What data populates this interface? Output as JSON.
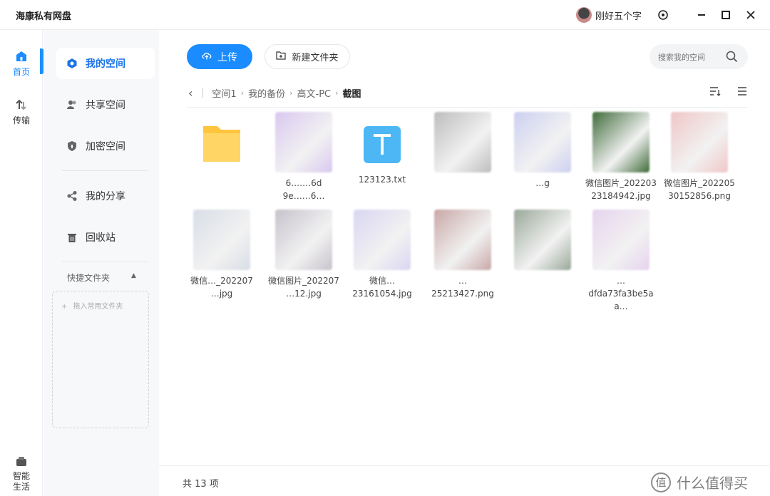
{
  "app": {
    "title": "海康私有网盘"
  },
  "user": {
    "name": "刚好五个字"
  },
  "rail": [
    {
      "label": "首页",
      "icon": "home-icon"
    },
    {
      "label": "传输",
      "icon": "transfer-icon"
    },
    {
      "label": "智能\n生活",
      "icon": "smart-life-icon"
    }
  ],
  "sidebar": {
    "items": [
      {
        "label": "我的空间",
        "icon": "my-space-icon",
        "active": true
      },
      {
        "label": "共享空间",
        "icon": "shared-space-icon"
      },
      {
        "label": "加密空间",
        "icon": "encrypted-space-icon"
      },
      {
        "label": "我的分享",
        "icon": "share-icon"
      },
      {
        "label": "回收站",
        "icon": "trash-icon"
      }
    ],
    "quick": {
      "label": "快捷文件夹",
      "hint": "拖入常用文件夹"
    }
  },
  "toolbar": {
    "upload_label": "上传",
    "newfolder_label": "新建文件夹",
    "search_placeholder": "搜索我的空间"
  },
  "breadcrumb": {
    "items": [
      "空间1",
      "我的备份",
      "高文-PC"
    ],
    "current": "截图"
  },
  "files": [
    {
      "name": "",
      "kind": "folder"
    },
    {
      "name": "6.……6d\n9e……6…",
      "kind": "image",
      "color": "#d9c8f0"
    },
    {
      "name": "123123.txt",
      "kind": "text"
    },
    {
      "name": "",
      "kind": "image",
      "color": "#bdbdbd"
    },
    {
      "name": "…g",
      "kind": "image",
      "color": "#cdd0f0"
    },
    {
      "name": "微信图片_202203\n23184942.jpg",
      "kind": "image",
      "color": "#3f6b3a"
    },
    {
      "name": "微信图片_202205\n30152856.png",
      "kind": "image",
      "color": "#f0c6c6"
    },
    {
      "name": "微信…_202207\n…jpg",
      "kind": "image",
      "color": "#d8dde6"
    },
    {
      "name": "微信图片_202207\n…12.jpg",
      "kind": "image",
      "color": "#c8c2cc"
    },
    {
      "name": "微信…\n23161054.jpg",
      "kind": "image",
      "color": "#d9d6f2"
    },
    {
      "name": "…\n25213427.png",
      "kind": "image",
      "color": "#c9a7a7"
    },
    {
      "name": "",
      "kind": "image",
      "color": "#9aa89a"
    },
    {
      "name": "…\ndfda73fa3be5aa…",
      "kind": "image",
      "color": "#e6d3ee"
    }
  ],
  "status": {
    "count": "共 13 项"
  },
  "watermark": {
    "glyph": "值",
    "text": "什么值得买"
  },
  "colors": {
    "accent": "#1a8cff",
    "folder": "#ffc53d",
    "txt": "#4db6f5"
  }
}
